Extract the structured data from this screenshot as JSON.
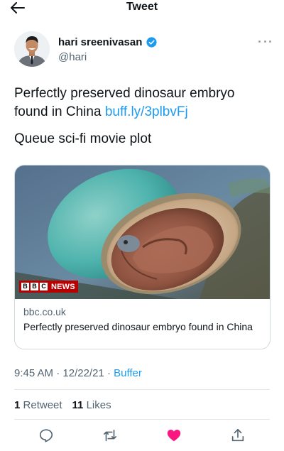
{
  "header": {
    "title": "Tweet",
    "back_icon": "back-arrow-icon"
  },
  "author": {
    "name": "hari sreenivasan",
    "handle": "@hari",
    "verified": true,
    "verified_color": "#1d9bf0"
  },
  "tweet": {
    "text_prefix": "Perfectly preserved dinosaur embryo found in China ",
    "link_text": "buff.ly/3plbvFj",
    "second_line": "Queue sci-fi movie plot",
    "link_color": "#1d9bf0"
  },
  "card": {
    "badge_letters": [
      "B",
      "B",
      "C"
    ],
    "badge_text": "NEWS",
    "badge_color": "#b80000",
    "domain": "bbc.co.uk",
    "title": "Perfectly preserved dinosaur embryo found in China"
  },
  "meta": {
    "time": "9:45 AM",
    "separator": "·",
    "date": "12/22/21",
    "source": "Buffer"
  },
  "stats": {
    "retweets_count": "1",
    "retweets_label": "Retweet",
    "likes_count": "11",
    "likes_label": "Likes"
  },
  "actions": {
    "reply_icon": "reply-icon",
    "retweet_icon": "retweet-icon",
    "like_icon": "heart-filled-icon",
    "share_icon": "share-icon",
    "liked": true,
    "like_color": "#f91880"
  }
}
